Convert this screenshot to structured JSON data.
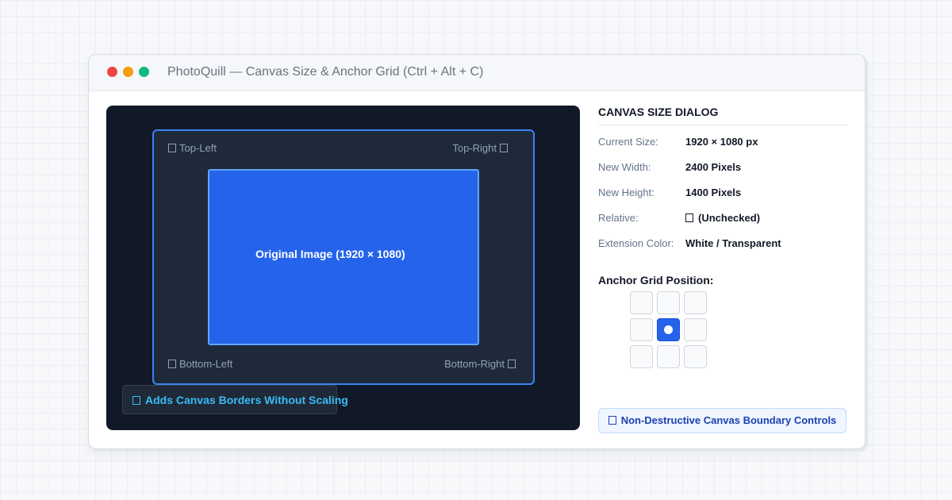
{
  "window": {
    "title": "PhotoQuill — Canvas Size & Anchor Grid (Ctrl + Alt + C)"
  },
  "preview": {
    "corners": {
      "top_left": "Top-Left",
      "top_right": "Top-Right",
      "bottom_left": "Bottom-Left",
      "bottom_right": "Bottom-Right"
    },
    "original_label": "Original Image (1920 × 1080)",
    "badge": "Adds Canvas Borders Without Scaling"
  },
  "dialog": {
    "title": "CANVAS SIZE DIALOG",
    "fields": [
      {
        "label": "Current Size:",
        "value": "1920 × 1080 px"
      },
      {
        "label": "New Width:",
        "value": "2400 Pixels"
      },
      {
        "label": "New Height:",
        "value": "1400 Pixels"
      },
      {
        "label": "Relative:",
        "value": "(Unchecked)"
      },
      {
        "label": "Extension Color:",
        "value": "White / Transparent"
      }
    ],
    "anchor_title": "Anchor Grid Position:",
    "anchor_selected": "middle-center",
    "callout": "Non-Destructive Canvas Boundary Controls"
  },
  "colors": {
    "accent": "#2563eb",
    "badge_text": "#38bdf8",
    "traffic_red": "#ef4444",
    "traffic_yellow": "#f59e0b",
    "traffic_green": "#10b981"
  }
}
